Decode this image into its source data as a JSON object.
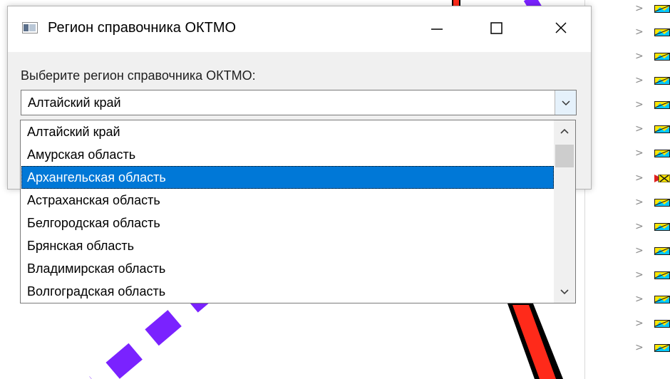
{
  "dialog": {
    "title": "Регион справочника ОКТМО",
    "prompt": "Выберите регион справочника ОКТМО:",
    "icons": {
      "app": "window-icon",
      "minimize": "minimize-icon",
      "maximize": "maximize-icon",
      "close": "close-icon"
    },
    "combo": {
      "value": "Алтайский край",
      "arrow_icon": "chevron-down-icon"
    },
    "dropdown": {
      "options": [
        "Алтайский край",
        "Амурская область",
        "Архангельская область",
        "Астраханская область",
        "Белгородская область",
        "Брянская область",
        "Владимирская область",
        "Волгоградская область"
      ],
      "selected": "Архангельская область",
      "scroll_up_icon": "chevron-up-icon",
      "scroll_down_icon": "chevron-down-icon"
    }
  },
  "layer_tree": {
    "chevron": ">",
    "rows": [
      "layer-icon",
      "layer-icon",
      "layer-icon",
      "layer-icon",
      "layer-icon",
      "layer-icon",
      "layer-icon",
      "warning-layer-icon",
      "layer-icon",
      "layer-icon",
      "layer-icon",
      "layer-icon",
      "layer-icon",
      "layer-icon",
      "layer-icon"
    ]
  },
  "colors": {
    "selection": "#0078d7",
    "road_red": "#ff0000",
    "route_purple": "#7a22ff",
    "layer_yellow": "#ffe600",
    "layer_cyan": "#00c8ff",
    "warning_red": "#e02020"
  }
}
